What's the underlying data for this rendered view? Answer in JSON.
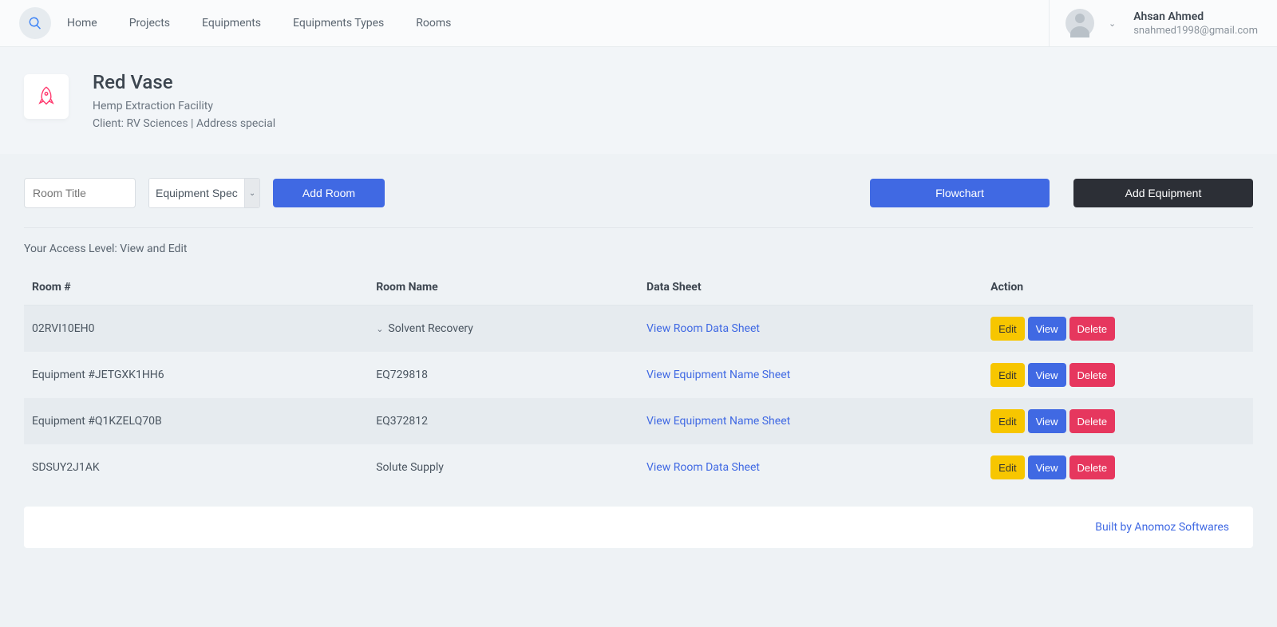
{
  "nav": {
    "links": [
      "Home",
      "Projects",
      "Equipments",
      "Equipments Types",
      "Rooms"
    ]
  },
  "user": {
    "name": "Ahsan Ahmed",
    "email": "snahmed1998@gmail.com"
  },
  "project": {
    "title": "Red Vase",
    "subtitle1": "Hemp Extraction Facility",
    "subtitle2": "Client: RV Sciences | Address special"
  },
  "toolbar": {
    "room_title_placeholder": "Room Title",
    "equipment_spec_label": "Equipment Spec",
    "add_room_label": "Add Room",
    "flowchart_label": "Flowchart",
    "add_equipment_label": "Add Equipment"
  },
  "access": {
    "label": "Your Access Level: ",
    "value": "View and Edit"
  },
  "table": {
    "headers": {
      "room_no": "Room #",
      "room_name": "Room Name",
      "data_sheet": "Data Sheet",
      "action": "Action"
    },
    "action_labels": {
      "edit": "Edit",
      "view": "View",
      "delete": "Delete"
    },
    "rows": [
      {
        "id": "02RVI10EH0",
        "name": "Solvent Recovery",
        "sheet": "View Room Data Sheet",
        "expandable": true
      },
      {
        "id": "Equipment #JETGXK1HH6",
        "name": "EQ729818",
        "sheet": "View Equipment Name Sheet",
        "expandable": false
      },
      {
        "id": "Equipment #Q1KZELQ70B",
        "name": "EQ372812",
        "sheet": "View Equipment Name Sheet",
        "expandable": false
      },
      {
        "id": "SDSUY2J1AK",
        "name": "Solute Supply",
        "sheet": "View Room Data Sheet",
        "expandable": false
      }
    ]
  },
  "footer": {
    "credit": "Built by Anomoz Softwares"
  }
}
